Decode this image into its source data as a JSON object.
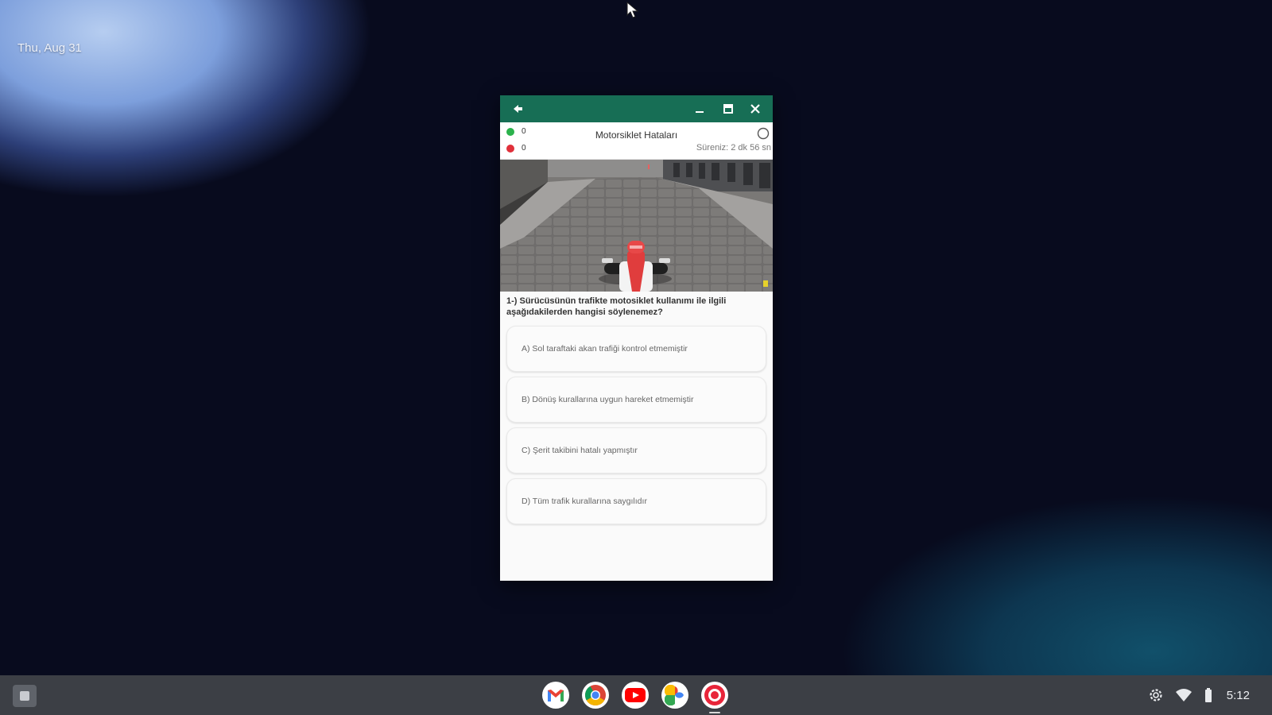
{
  "desktop": {
    "date": "Thu, Aug 31"
  },
  "window": {
    "titlebar": {
      "back_icon": "back-arrow-icon",
      "minimize_icon": "minimize-icon",
      "maximize_icon": "maximize-icon",
      "close_icon": "close-icon",
      "color": "#176e55"
    },
    "header": {
      "title": "Motorsiklet Hataları",
      "correct_count": "0",
      "wrong_count": "0",
      "timer": "Süreniz: 2 dk 56 sn"
    },
    "question": {
      "text": "1-) Sürücüsünün trafikte motosiklet kullanımı ile ilgili aşağıdakilerden hangisi söylenemez?"
    },
    "options": [
      "A) Sol taraftaki akan trafiği kontrol etmemiştir",
      "B) Dönüş kurallarına uygun hareket etmemiştir",
      "C) Şerit takibini hatalı yapmıştır",
      "D) Tüm trafik kurallarına saygılıdır"
    ]
  },
  "shelf": {
    "apps": [
      "gmail-icon",
      "chrome-icon",
      "youtube-icon",
      "photos-icon",
      "app-icon"
    ],
    "time": "5:12"
  }
}
